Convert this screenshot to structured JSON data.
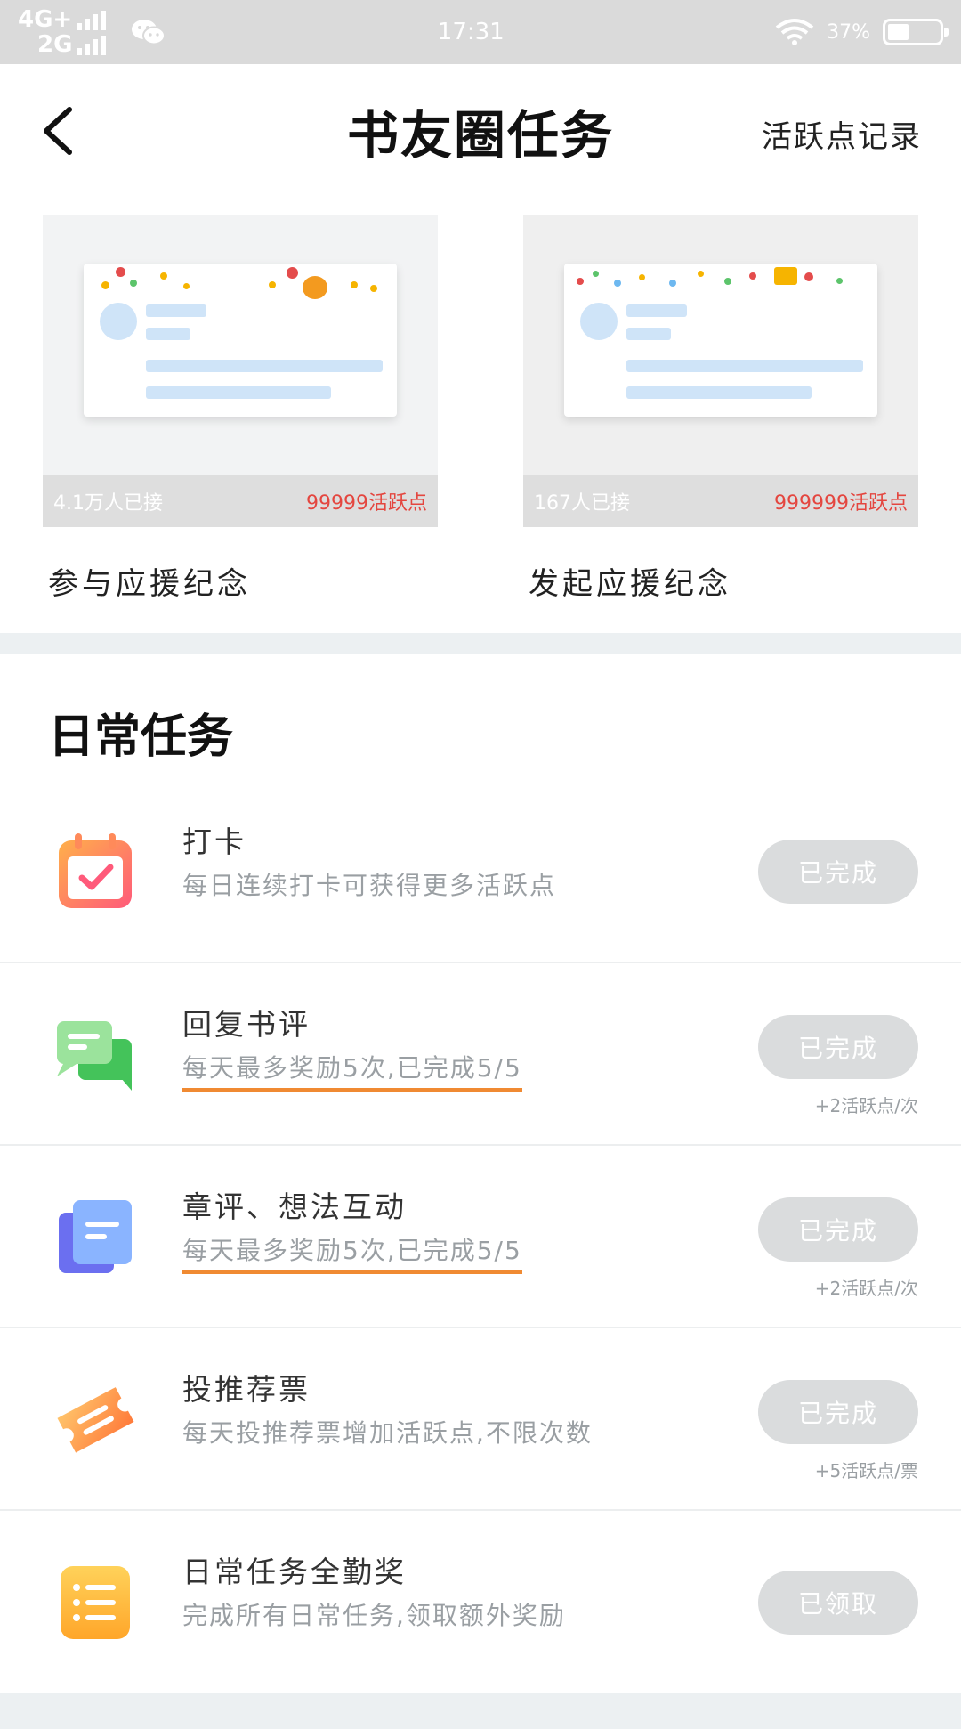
{
  "status_bar": {
    "network_top": "4G+",
    "network_bottom": "2G",
    "time": "17:31",
    "battery": "37%",
    "battery_level": 0.37
  },
  "header": {
    "title": "书友圈任务",
    "record_link": "活跃点记录"
  },
  "cards": [
    {
      "joined": "4.1万人已接",
      "points": "99999活跃点",
      "label": "参与应援纪念"
    },
    {
      "joined": "167人已接",
      "points": "999999活跃点",
      "label": "发起应援纪念"
    }
  ],
  "daily": {
    "title": "日常任务",
    "tasks": [
      {
        "name": "打卡",
        "desc": "每日连续打卡可获得更多活跃点",
        "button": "已完成",
        "reward": ""
      },
      {
        "name": "回复书评",
        "desc": "每天最多奖励5次,已完成5/5",
        "button": "已完成",
        "reward": "+2活跃点/次"
      },
      {
        "name": "章评、想法互动",
        "desc": "每天最多奖励5次,已完成5/5",
        "button": "已完成",
        "reward": "+2活跃点/次"
      },
      {
        "name": "投推荐票",
        "desc": "每天投推荐票增加活跃点,不限次数",
        "button": "已完成",
        "reward": "+5活跃点/票"
      },
      {
        "name": "日常任务全勤奖",
        "desc": "完成所有日常任务,领取额外奖励",
        "button": "已领取",
        "reward": ""
      }
    ]
  },
  "colors": {
    "accent_red": "#e4463f",
    "underline_orange": "#f08a32",
    "button_gray": "#dadcdd",
    "section_separator": "#ecf0f2"
  },
  "icons": {
    "checkin": "calendar-check-icon",
    "reply": "chat-bubbles-icon",
    "chapter": "document-stack-icon",
    "vote": "ticket-icon",
    "attendance": "list-icon"
  }
}
